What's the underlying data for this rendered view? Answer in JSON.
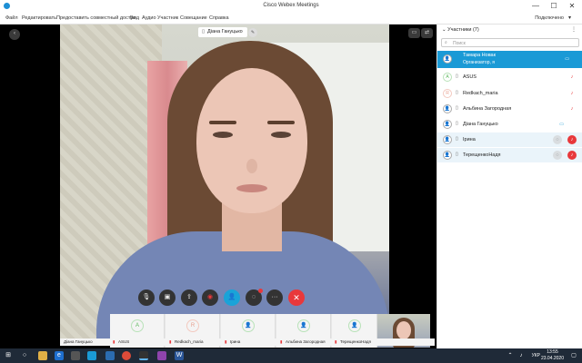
{
  "window": {
    "title": "Cisco Webex Meetings",
    "minimize": "—",
    "maximize": "☐",
    "close": "✕"
  },
  "menu": {
    "items": [
      "Файл",
      "Редактировать",
      "Предоставить совместный доступ",
      "Вид",
      "Аудио",
      "Участник",
      "Совещание",
      "Справка"
    ],
    "connection_status": "Подключено"
  },
  "stage": {
    "active_speaker": "Діана Гануцько",
    "collapse_icon": "‹",
    "layout_icon": "▭",
    "swap_icon": "⇄"
  },
  "controls": {
    "mute_icon": "mic-off-icon",
    "video_icon": "video-icon",
    "share_icon": "share-icon",
    "record_icon": "record-icon",
    "participants_icon": "participants-icon",
    "chat_icon": "chat-icon",
    "more_icon": "more-icon",
    "leave_icon": "✕",
    "colors": {
      "active": "#1aa3d8",
      "leave": "#e8383b"
    }
  },
  "filmstrip": {
    "thumbs": [
      {
        "initial": "A",
        "color": "#5cb85c",
        "border": "#b8e2b8"
      },
      {
        "initial": "R",
        "color": "#e8a090",
        "border": "#f3c9bf"
      },
      {
        "initial": "",
        "color": "#5cb85c",
        "border": "#b8e2b8"
      },
      {
        "initial": "",
        "color": "#5cb85c",
        "border": "#b8e2b8"
      },
      {
        "initial": "",
        "color": "#5cb85c",
        "border": "#b8e2b8"
      }
    ],
    "names": [
      "Діана Гануцько",
      "ASUS",
      "Redkach_maria",
      "Ірина",
      "Альбина Загородная",
      "ТерещенкоНадя"
    ]
  },
  "participants_panel": {
    "header": "Участники (7)",
    "search_placeholder": "Поиск",
    "participants": [
      {
        "name": "Тамара Новак",
        "role": "Организатор, я",
        "initial": "",
        "has_video": true,
        "mic": "",
        "row": "host"
      },
      {
        "name": "ASUS",
        "role": "",
        "initial": "A",
        "has_video": false,
        "mic": "muted",
        "row": "normal"
      },
      {
        "name": "Redkach_maria",
        "role": "",
        "initial": "R",
        "has_video": false,
        "mic": "muted",
        "row": "normal"
      },
      {
        "name": "Альбина Загородная",
        "role": "",
        "initial": "",
        "has_video": false,
        "mic": "muted",
        "row": "normal"
      },
      {
        "name": "Діана Гануцько",
        "role": "",
        "initial": "",
        "has_video": true,
        "mic": "",
        "row": "normal"
      },
      {
        "name": "Ірина",
        "role": "",
        "initial": "",
        "has_video": false,
        "mic": "muted-bg",
        "row": "shaded"
      },
      {
        "name": "ТерещенкоНадя",
        "role": "",
        "initial": "",
        "has_video": false,
        "mic": "muted-bg",
        "row": "shaded"
      }
    ]
  },
  "taskbar": {
    "language": "УКР",
    "time": "13:55",
    "date": "23.04.2020"
  }
}
